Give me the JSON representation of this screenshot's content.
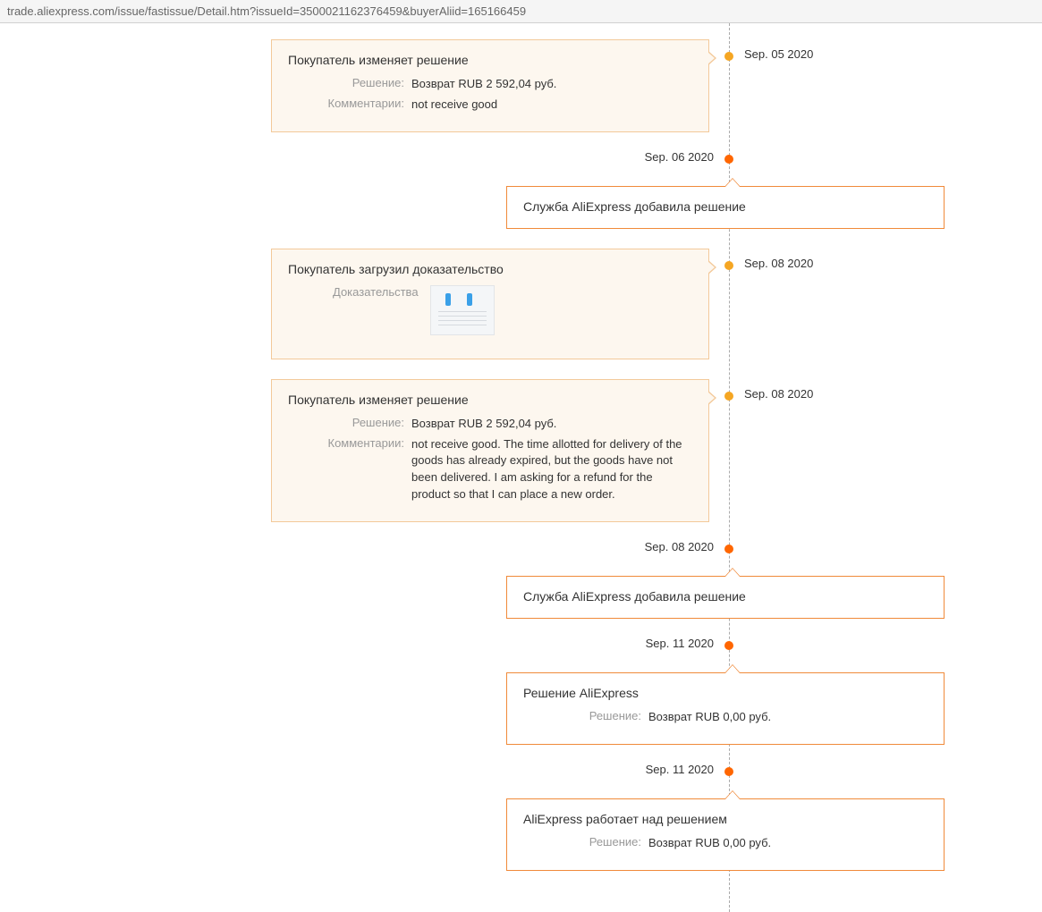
{
  "url": "trade.aliexpress.com/issue/fastissue/Detail.htm?issueId=3500021162376459&buyerAliid=165166459",
  "labels": {
    "decision": "Решение:",
    "comments": "Комментарии:",
    "evidence": "Доказательства"
  },
  "events": [
    {
      "side": "left",
      "dot": "amber",
      "date": "Sep. 05 2020",
      "title": "Покупатель изменяет решение",
      "decision": "Возврат RUB 2 592,04 руб.",
      "comments": "not receive good"
    },
    {
      "side": "right",
      "dot": "orange",
      "date": "Sep. 06 2020",
      "title": "Служба AliExpress добавила решение"
    },
    {
      "side": "left",
      "dot": "amber",
      "date": "Sep. 08 2020",
      "title": "Покупатель загрузил доказательство",
      "evidence": true
    },
    {
      "side": "left",
      "dot": "amber",
      "date": "Sep. 08 2020",
      "title": "Покупатель изменяет решение",
      "decision": "Возврат RUB 2 592,04 руб.",
      "comments": "not receive good. The time allotted for delivery of the goods has already expired, but the goods have not been delivered. I am asking for a refund for the product so that I can place a new order."
    },
    {
      "side": "right",
      "dot": "orange",
      "date": "Sep. 08 2020",
      "title": "Служба AliExpress добавила решение"
    },
    {
      "side": "right",
      "dot": "orange",
      "date": "Sep. 11 2020",
      "title": "Решение AliExpress",
      "decision": "Возврат RUB 0,00 руб."
    },
    {
      "side": "right",
      "dot": "orange",
      "date": "Sep. 11 2020",
      "title": "AliExpress работает над решением",
      "decision": "Возврат RUB 0,00 руб."
    }
  ]
}
